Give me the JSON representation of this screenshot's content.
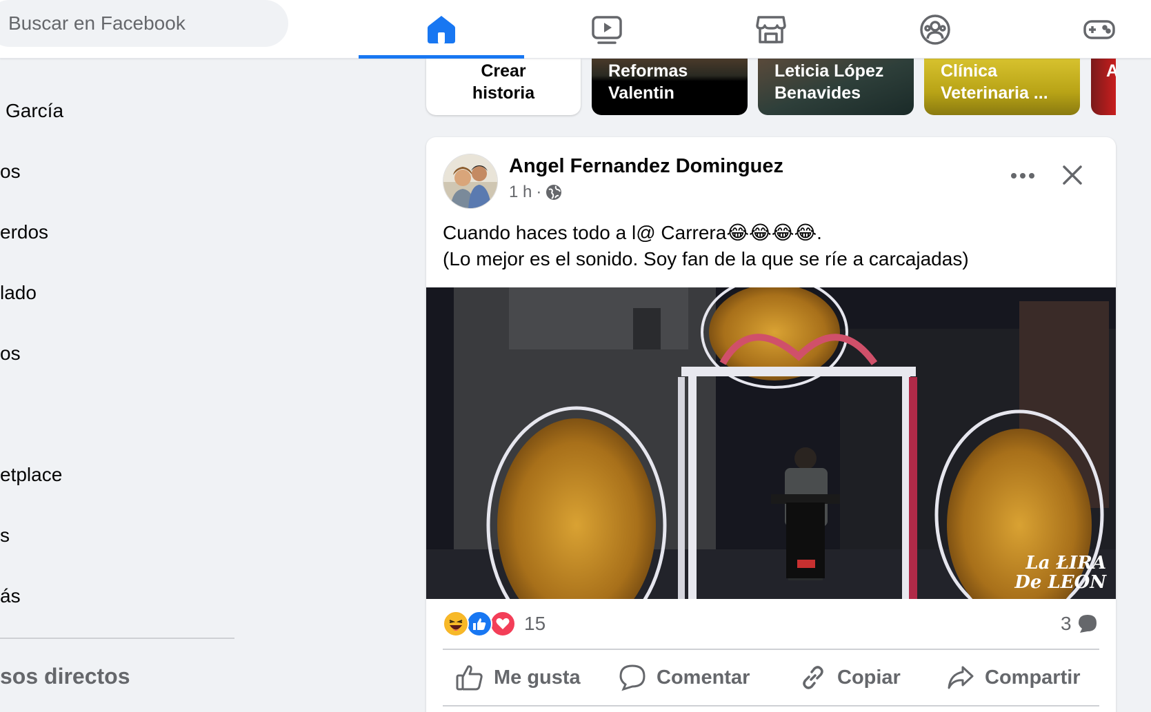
{
  "search": {
    "placeholder": "Buscar en Facebook"
  },
  "nav": {
    "tabs": [
      {
        "name": "home",
        "icon": "home-icon",
        "active": true
      },
      {
        "name": "watch",
        "icon": "video-icon",
        "active": false
      },
      {
        "name": "marketplace",
        "icon": "store-icon",
        "active": false
      },
      {
        "name": "groups",
        "icon": "groups-icon",
        "active": false
      },
      {
        "name": "gaming",
        "icon": "gamepad-icon",
        "active": false
      }
    ],
    "accent_color": "#1877f2"
  },
  "sidebar": {
    "items": [
      {
        "label": "García"
      },
      {
        "label": "os"
      },
      {
        "label": "erdos"
      },
      {
        "label": "lado"
      },
      {
        "label": "os"
      },
      {
        "label": "etplace"
      },
      {
        "label": "s"
      },
      {
        "label": "ás"
      }
    ],
    "heading": "sos directos"
  },
  "stories": [
    {
      "label_line1": "Crear",
      "label_line2": "historia"
    },
    {
      "label_line1": "Reformas",
      "label_line2": "Valentin"
    },
    {
      "label_line1": "Leticia López",
      "label_line2": "Benavides"
    },
    {
      "label_line1": "Clínica",
      "label_line2": "Veterinaria ..."
    },
    {
      "label_line1": "A",
      "label_line2": ""
    }
  ],
  "post": {
    "author": "Angel Fernandez Dominguez",
    "time": "1 h",
    "separator": "·",
    "text_line1": "Cuando haces todo a l@ Carrera😂😂😂😂.",
    "text_line2": "(Lo mejor es el sonido. Soy fan de la que se ríe a carcajadas)",
    "watermark_line1": "La ŁIRA",
    "watermark_line2": "De LEON",
    "reactions": [
      "haha",
      "like",
      "love"
    ],
    "reaction_count": "15",
    "comment_count": "3",
    "actions": {
      "like": "Me gusta",
      "comment": "Comentar",
      "copy": "Copiar",
      "share": "Compartir"
    }
  }
}
